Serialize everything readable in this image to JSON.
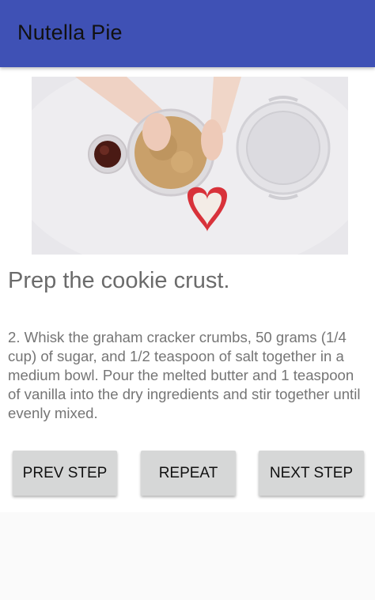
{
  "app_bar": {
    "title": "Nutella Pie"
  },
  "media": {
    "icon": "recipe-step-video-frame"
  },
  "step": {
    "title": "Prep the cookie crust.",
    "instruction": "2. Whisk the graham cracker crumbs, 50 grams (1/4 cup) of sugar, and 1/2 teaspoon of salt together in a medium bowl. Pour the melted butter and 1 teaspoon of vanilla into the dry ingredients and stir together until evenly mixed."
  },
  "controls": {
    "prev_label": "PREV STEP",
    "repeat_label": "REPEAT",
    "next_label": "NEXT STEP"
  },
  "colors": {
    "app_bar": "#3f51b5",
    "button_bg": "#d6d7d7",
    "text_secondary": "#757575"
  }
}
